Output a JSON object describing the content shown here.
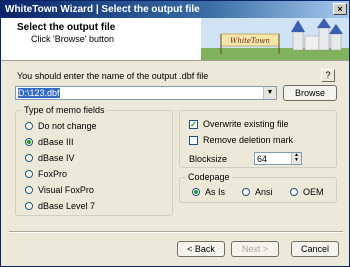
{
  "window": {
    "title": "WhiteTown Wizard | Select the output file",
    "close_glyph": "×"
  },
  "header": {
    "title": "Select the output file",
    "subtitle": "Click 'Browse' button",
    "logo_text": "WhiteTown"
  },
  "instruction": "You should enter the name of the output .dbf file",
  "help_label": "?",
  "path_input": {
    "value": "D:\\123.dbf"
  },
  "browse_label": "Browse",
  "memo_group": {
    "title": "Type of memo fields",
    "options": [
      "Do not change",
      "dBase III",
      "dBase IV",
      "FoxPro",
      "Visual FoxPro",
      "dBase Level 7"
    ],
    "selected": "dBase III"
  },
  "options_group": {
    "overwrite_label": "Overwrite existing file",
    "overwrite_checked": true,
    "remove_deletion_label": "Remove deletion mark",
    "remove_deletion_checked": false,
    "blocksize_label": "Blocksize",
    "blocksize_value": "64"
  },
  "codepage_group": {
    "title": "Codepage",
    "options": [
      "As Is",
      "Ansi",
      "OEM"
    ],
    "selected": "As Is"
  },
  "footer": {
    "back_label": "Back",
    "next_label": "Next",
    "cancel_label": "Cancel"
  },
  "colors": {
    "titlebar": "#0a246a",
    "selection": "#316ac5",
    "radio_dot": "#21a121"
  }
}
